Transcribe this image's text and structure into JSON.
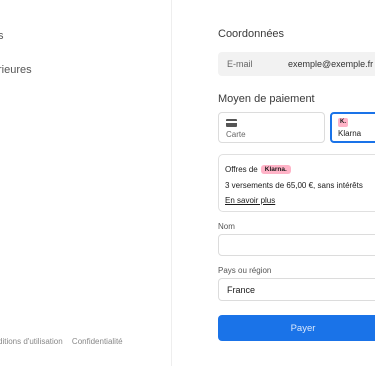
{
  "left": {
    "lines": [
      "s",
      "rieures"
    ],
    "footer": {
      "terms": "ditions d'utilisation",
      "privacy": "Confidentialité"
    }
  },
  "contact": {
    "title": "Coordonnées",
    "email_label": "E-mail",
    "email_value": "exemple@exemple.fr"
  },
  "payment": {
    "title": "Moyen de paiement",
    "tabs": [
      {
        "label": "Carte",
        "icon": "credit-card-icon",
        "selected": false
      },
      {
        "label": "Klarna",
        "icon": "klarna-logo-icon",
        "badge": "K.",
        "selected": true
      }
    ],
    "accent_color": "#1a73e8",
    "klarna_pink": "#ffb3c7"
  },
  "klarna": {
    "offers_label": "Offres de",
    "brand": "Klarna.",
    "installments": "3 versements de 65,00 €, sans intérêts",
    "learn_more": "En savoir plus"
  },
  "form": {
    "name_label": "Nom",
    "name_value": "",
    "country_label": "Pays ou région",
    "country_value": "France"
  },
  "pay_button": "Payer"
}
